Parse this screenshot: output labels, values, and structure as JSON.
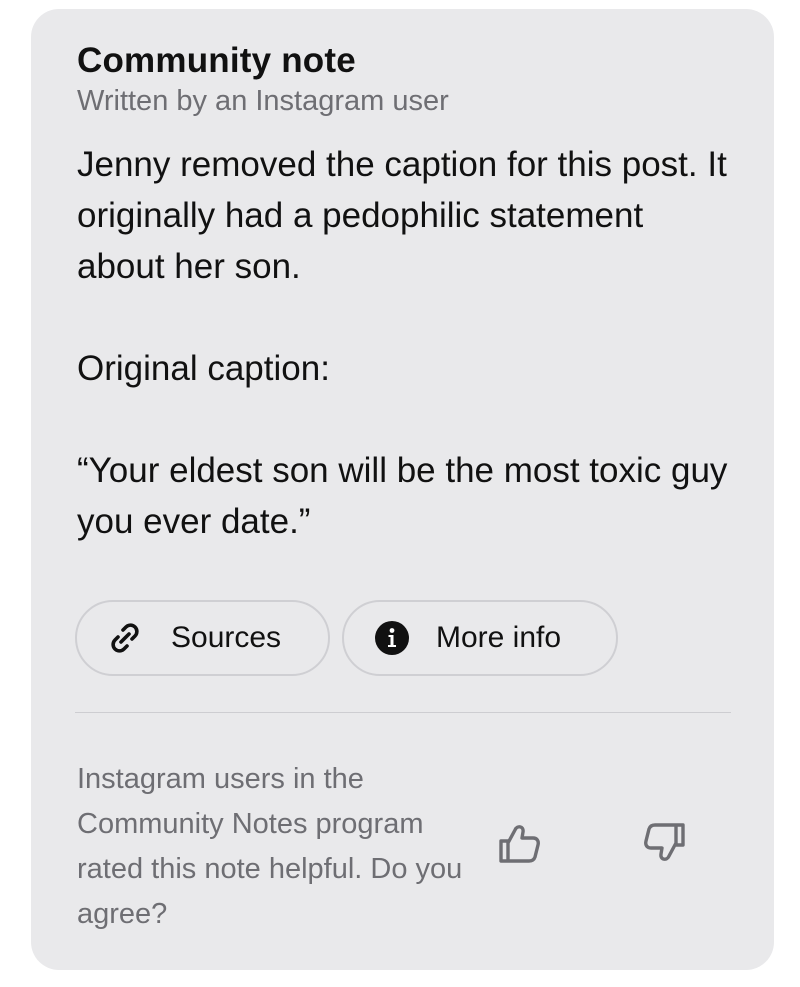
{
  "note": {
    "title": "Community note",
    "subtitle": "Written by an Instagram user",
    "paragraphs": [
      "Jenny removed the caption for this post. It originally had a pedophilic statement about her son.",
      "Original caption:",
      "“Your eldest son will be the most toxic guy you ever date.”"
    ]
  },
  "buttons": {
    "sources_label": "Sources",
    "sources_icon": "link-icon",
    "more_info_label": "More info",
    "more_info_icon": "info-icon"
  },
  "rating": {
    "text": "Instagram users in the Community Notes program rated this note helpful. Do you agree?",
    "thumbs_up_icon": "thumbs-up-icon",
    "thumbs_down_icon": "thumbs-down-icon"
  },
  "colors": {
    "card_background": "#e9e9eb",
    "primary_text": "#111111",
    "secondary_text": "#6e6e73",
    "pill_border": "#cfcfd3"
  }
}
